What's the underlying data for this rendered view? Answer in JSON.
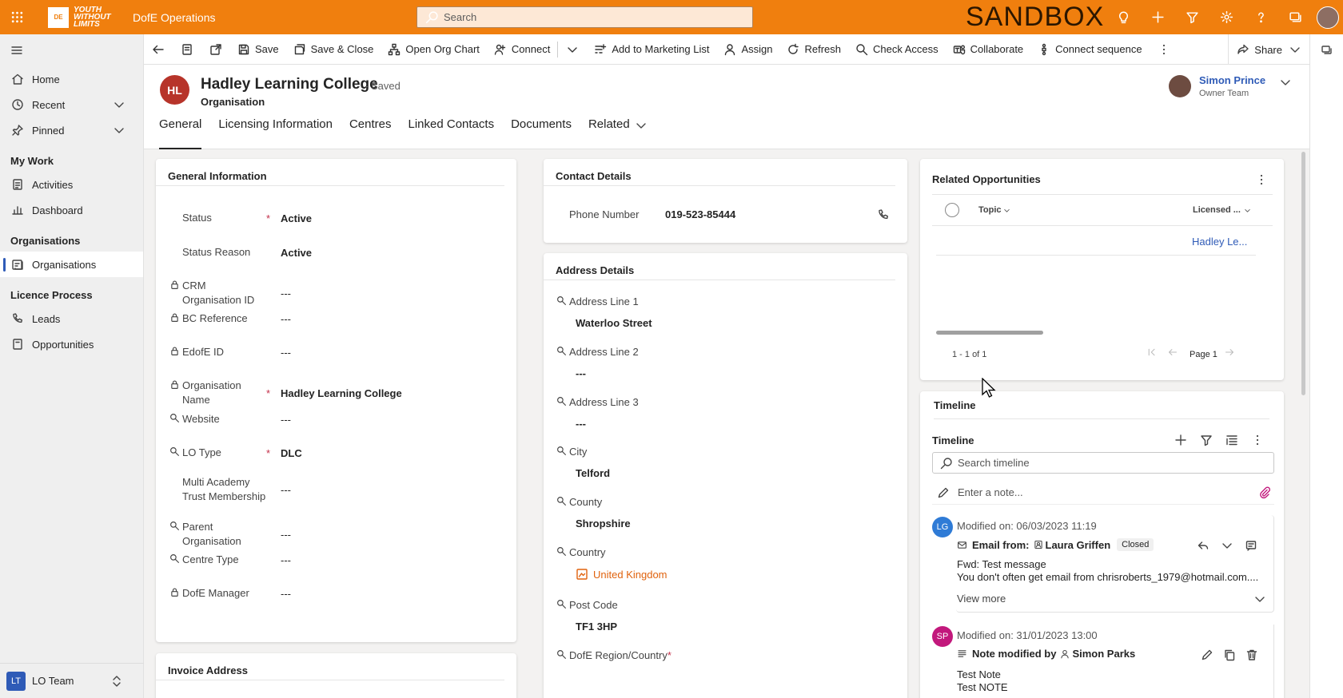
{
  "topbar": {
    "logo_mark": "DE",
    "logo_text": "YOUTH WITHOUT LIMITS",
    "app_name": "DofE Operations",
    "search_placeholder": "Search",
    "environment": "SANDBOX",
    "color": "#f07f0e"
  },
  "sidebar": {
    "items_top": [
      {
        "label": "Home",
        "icon": "home-icon"
      },
      {
        "label": "Recent",
        "icon": "clock-icon"
      },
      {
        "label": "Pinned",
        "icon": "pin-icon"
      }
    ],
    "groups": [
      {
        "title": "My Work",
        "items": [
          {
            "label": "Activities",
            "icon": "activity-icon"
          },
          {
            "label": "Dashboard",
            "icon": "dashboard-icon"
          }
        ]
      },
      {
        "title": "Organisations",
        "items": [
          {
            "label": "Organisations",
            "icon": "organisation-icon"
          }
        ]
      },
      {
        "title": "Licence Process",
        "items": [
          {
            "label": "Leads",
            "icon": "phone-icon"
          },
          {
            "label": "Opportunities",
            "icon": "document-icon"
          }
        ]
      }
    ],
    "area": {
      "badge": "LT",
      "label": "LO Team"
    }
  },
  "commands": {
    "save": "Save",
    "save_close": "Save & Close",
    "org_chart": "Open Org Chart",
    "connect": "Connect",
    "marketing": "Add to Marketing List",
    "assign": "Assign",
    "refresh": "Refresh",
    "check_access": "Check Access",
    "collaborate": "Collaborate",
    "sequence": "Connect sequence",
    "share": "Share"
  },
  "record": {
    "initials": "HL",
    "title": "Hadley Learning College",
    "saved": "- Saved",
    "entity": "Organisation",
    "owner_name": "Simon Prince",
    "owner_role": "Owner Team",
    "tabs": [
      "General",
      "Licensing Information",
      "Centres",
      "Linked Contacts",
      "Documents",
      "Related"
    ]
  },
  "general": {
    "title": "General Information",
    "fields": [
      {
        "label": "Status",
        "required": "*",
        "value": "Active"
      },
      {
        "label": "Status Reason",
        "required": "",
        "value": "Active"
      },
      {
        "label": "CRM Organisation ID",
        "required": "",
        "value": "---"
      },
      {
        "label": "BC Reference",
        "required": "",
        "value": "---"
      },
      {
        "label": "EdofE ID",
        "required": "",
        "value": "---"
      },
      {
        "label": "Organisation Name",
        "required": "*",
        "value": "Hadley Learning College"
      },
      {
        "label": "Website",
        "required": "",
        "value": "---"
      },
      {
        "label": "LO Type",
        "required": "*",
        "value": "DLC"
      },
      {
        "label": "Multi Academy Trust Membership",
        "required": "",
        "value": "---"
      },
      {
        "label": "Parent Organisation",
        "required": "",
        "value": "---"
      },
      {
        "label": "Centre Type",
        "required": "",
        "value": "---"
      },
      {
        "label": "DofE Manager",
        "required": "",
        "value": "---"
      }
    ]
  },
  "invoice": {
    "title": "Invoice Address"
  },
  "contact": {
    "title": "Contact Details",
    "phone_label": "Phone Number",
    "phone_value": "019-523-85444"
  },
  "address": {
    "title": "Address Details",
    "fields": [
      {
        "label": "Address Line 1",
        "value": "Waterloo Street"
      },
      {
        "label": "Address Line 2",
        "value": "---"
      },
      {
        "label": "Address Line 3",
        "value": "---"
      },
      {
        "label": "City",
        "value": "Telford"
      },
      {
        "label": "County",
        "value": "Shropshire"
      },
      {
        "label": "Country",
        "value": "United Kingdom"
      },
      {
        "label": "Post Code",
        "value": "TF1 3HP"
      },
      {
        "label": "DofE Region/Country",
        "value": ""
      }
    ],
    "required_mark": "*"
  },
  "opportunities": {
    "title": "Related Opportunities",
    "col_topic": "Topic",
    "col_licensed": "Licensed ...",
    "row_value": "Hadley Le...",
    "range": "1 - 1 of 1",
    "page": "Page 1"
  },
  "timeline": {
    "section_title": "Timeline",
    "title": "Timeline",
    "search_placeholder": "Search timeline",
    "note_placeholder": "Enter a note...",
    "items": [
      {
        "initials": "LG",
        "avatar_color": "#2f7bd6",
        "modified": "Modified on: 06/03/2023 11:19",
        "kind": "Email from:",
        "person": "Laura Griffen",
        "badge": "Closed",
        "subject": "Fwd: Test message",
        "body": "You don't often get email from chrisroberts_1979@hotmail.com....",
        "more": "View more"
      },
      {
        "initials": "SP",
        "avatar_color": "#c2187c",
        "modified": "Modified on: 31/01/2023 13:00",
        "kind": "Note modified by",
        "person": "Simon Parks",
        "subject": "Test Note",
        "body": "Test NOTE"
      }
    ]
  }
}
